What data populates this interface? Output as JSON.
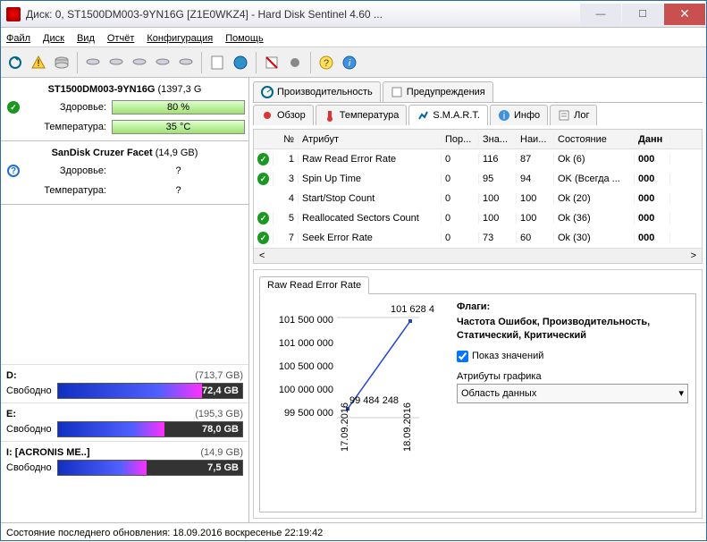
{
  "window": {
    "title": "Диск: 0, ST1500DM003-9YN16G [Z1E0WKZ4]  -  Hard Disk Sentinel 4.60 ..."
  },
  "menu": {
    "file": "Файл",
    "disk": "Диск",
    "view": "Вид",
    "report": "Отчёт",
    "config": "Конфигурация",
    "help": "Помощь"
  },
  "disks": [
    {
      "name": "ST1500DM003-9YN16G",
      "size": "(1397,3 G",
      "health_label": "Здоровье:",
      "health_value": "80 %",
      "temp_label": "Температура:",
      "temp_value": "35 °C",
      "status": "ok"
    },
    {
      "name": "SanDisk Cruzer Facet",
      "size": "(14,9 GB)",
      "health_label": "Здоровье:",
      "health_value": "?",
      "temp_label": "Температура:",
      "temp_value": "?",
      "status": "unknown"
    }
  ],
  "partitions": [
    {
      "drive": "D:",
      "size": "(713,7 GB)",
      "free_label": "Свободно",
      "free": "72,4 GB",
      "pct": 78
    },
    {
      "drive": "E:",
      "size": "(195,3 GB)",
      "free_label": "Свободно",
      "free": "78,0 GB",
      "pct": 58
    },
    {
      "drive": "I: [ACRONIS ME..]",
      "size": "(14,9 GB)",
      "free_label": "Свободно",
      "free": "7,5 GB",
      "pct": 48
    }
  ],
  "tabs_top": [
    {
      "label": "Производительность"
    },
    {
      "label": "Предупреждения"
    }
  ],
  "tabs_bottom": [
    {
      "label": "Обзор"
    },
    {
      "label": "Температура"
    },
    {
      "label": "S.M.A.R.T.",
      "active": true
    },
    {
      "label": "Инфо"
    },
    {
      "label": "Лог"
    }
  ],
  "smart": {
    "headers": {
      "no": "№",
      "attr": "Атрибут",
      "thr": "Пор...",
      "val": "Зна...",
      "wst": "Наи...",
      "stat": "Состояние",
      "data": "Данн"
    },
    "rows": [
      {
        "no": "1",
        "attr": "Raw Read Error Rate",
        "thr": "0",
        "val": "116",
        "wst": "87",
        "stat": "Ok (6)",
        "data": "000",
        "ok": true
      },
      {
        "no": "3",
        "attr": "Spin Up Time",
        "thr": "0",
        "val": "95",
        "wst": "94",
        "stat": "OK (Всегда ...",
        "data": "000",
        "ok": true
      },
      {
        "no": "4",
        "attr": "Start/Stop Count",
        "thr": "0",
        "val": "100",
        "wst": "100",
        "stat": "Ok (20)",
        "data": "000",
        "ok": false
      },
      {
        "no": "5",
        "attr": "Reallocated Sectors Count",
        "thr": "0",
        "val": "100",
        "wst": "100",
        "stat": "Ok (36)",
        "data": "000",
        "ok": true
      },
      {
        "no": "7",
        "attr": "Seek Error Rate",
        "thr": "0",
        "val": "73",
        "wst": "60",
        "stat": "Ok (30)",
        "data": "000",
        "ok": true
      }
    ]
  },
  "graph": {
    "tab": "Raw Read Error Rate",
    "y_ticks": [
      "101 500 000",
      "101 000 000",
      "100 500 000",
      "100 000 000",
      "99 500 000"
    ],
    "x_ticks": [
      "17.09.2016",
      "18.09.2016"
    ],
    "point_max": "101 628 4",
    "point_min": "99 484 248",
    "flags_title": "Флаги:",
    "flags": "Частота Ошибок, Производительность, Статический, Критический",
    "checkbox": "Показ значений",
    "combo_label": "Атрибуты графика",
    "combo_value": "Область данных"
  },
  "chart_data": {
    "type": "line",
    "title": "Raw Read Error Rate",
    "x": [
      "17.09.2016",
      "18.09.2016"
    ],
    "values": [
      99484248,
      101628400
    ],
    "ylabel": "",
    "ylim": [
      99500000,
      101500000
    ]
  },
  "status": "Состояние последнего обновления: 18.09.2016 воскресенье 22:19:42"
}
